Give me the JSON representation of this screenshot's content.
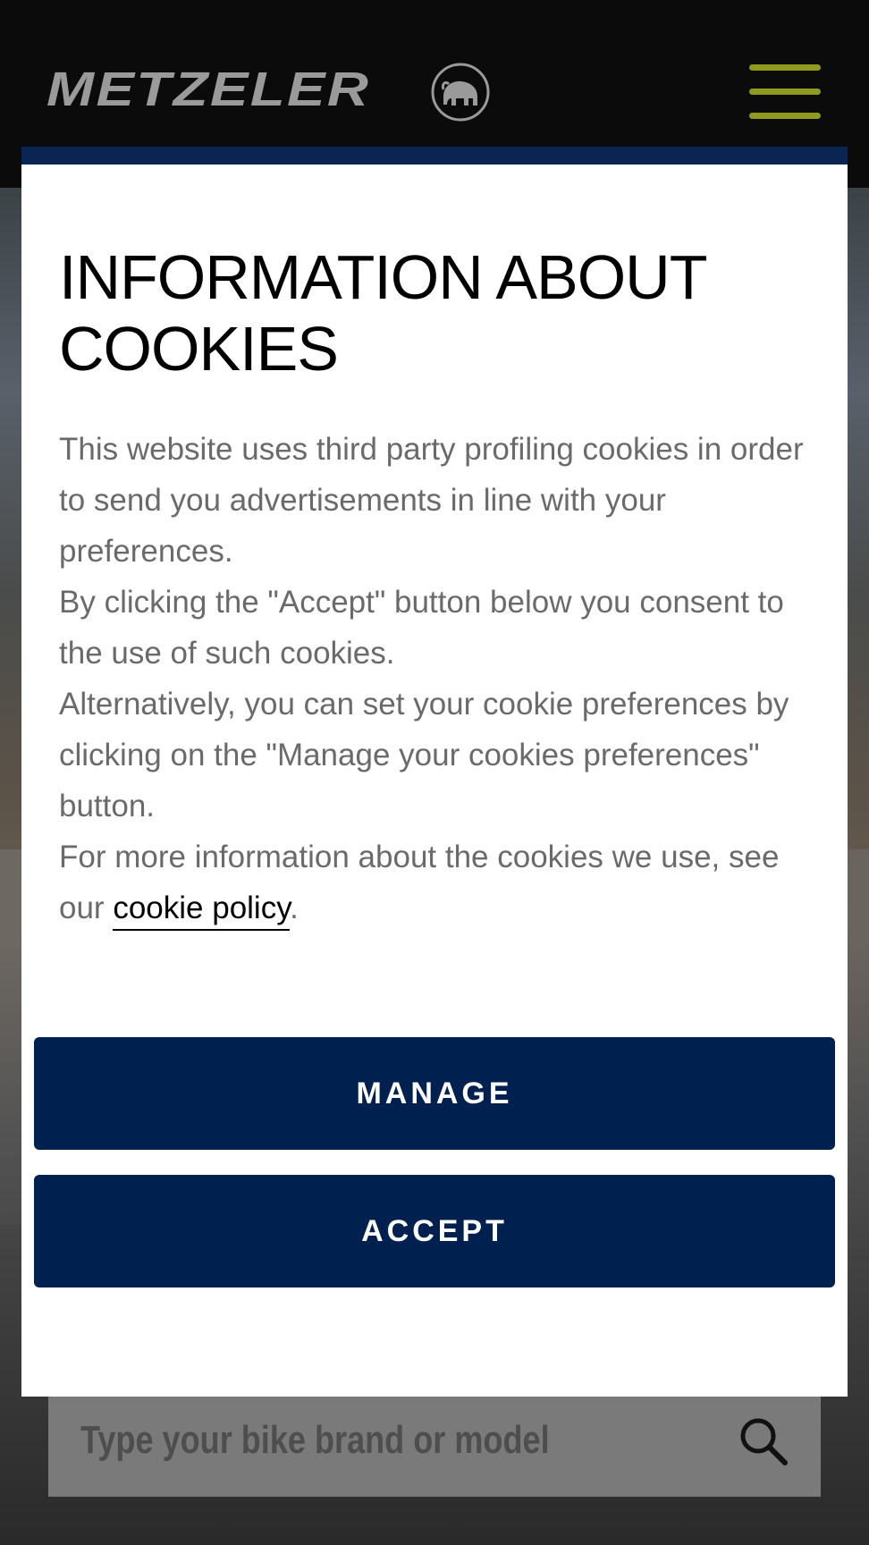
{
  "header": {
    "brand": "METZELER",
    "logo_icon": "elephant-emblem-icon",
    "menu_icon": "hamburger-menu-icon",
    "menu_color": "#8f9a1f"
  },
  "search": {
    "placeholder": "Type your bike brand or model",
    "icon": "search-icon"
  },
  "cookie_modal": {
    "title": "INFORMATION ABOUT COOKIES",
    "body_p1": "This website uses third party profiling cookies in order to send you advertisements in line with your preferences.",
    "body_p2": "By clicking the \"Accept\" button below you consent to the use of such cookies.",
    "body_p3": "Alternatively, you can set your cookie preferences by clicking on the \"Manage your cookies preferences\" button.",
    "body_p4_prefix": "For more information about the cookies we use, see our",
    "link_label": "cookie policy",
    "body_p4_suffix": ".",
    "manage_label": "MANAGE",
    "accept_label": "ACCEPT",
    "accent_color": "#00214f"
  }
}
